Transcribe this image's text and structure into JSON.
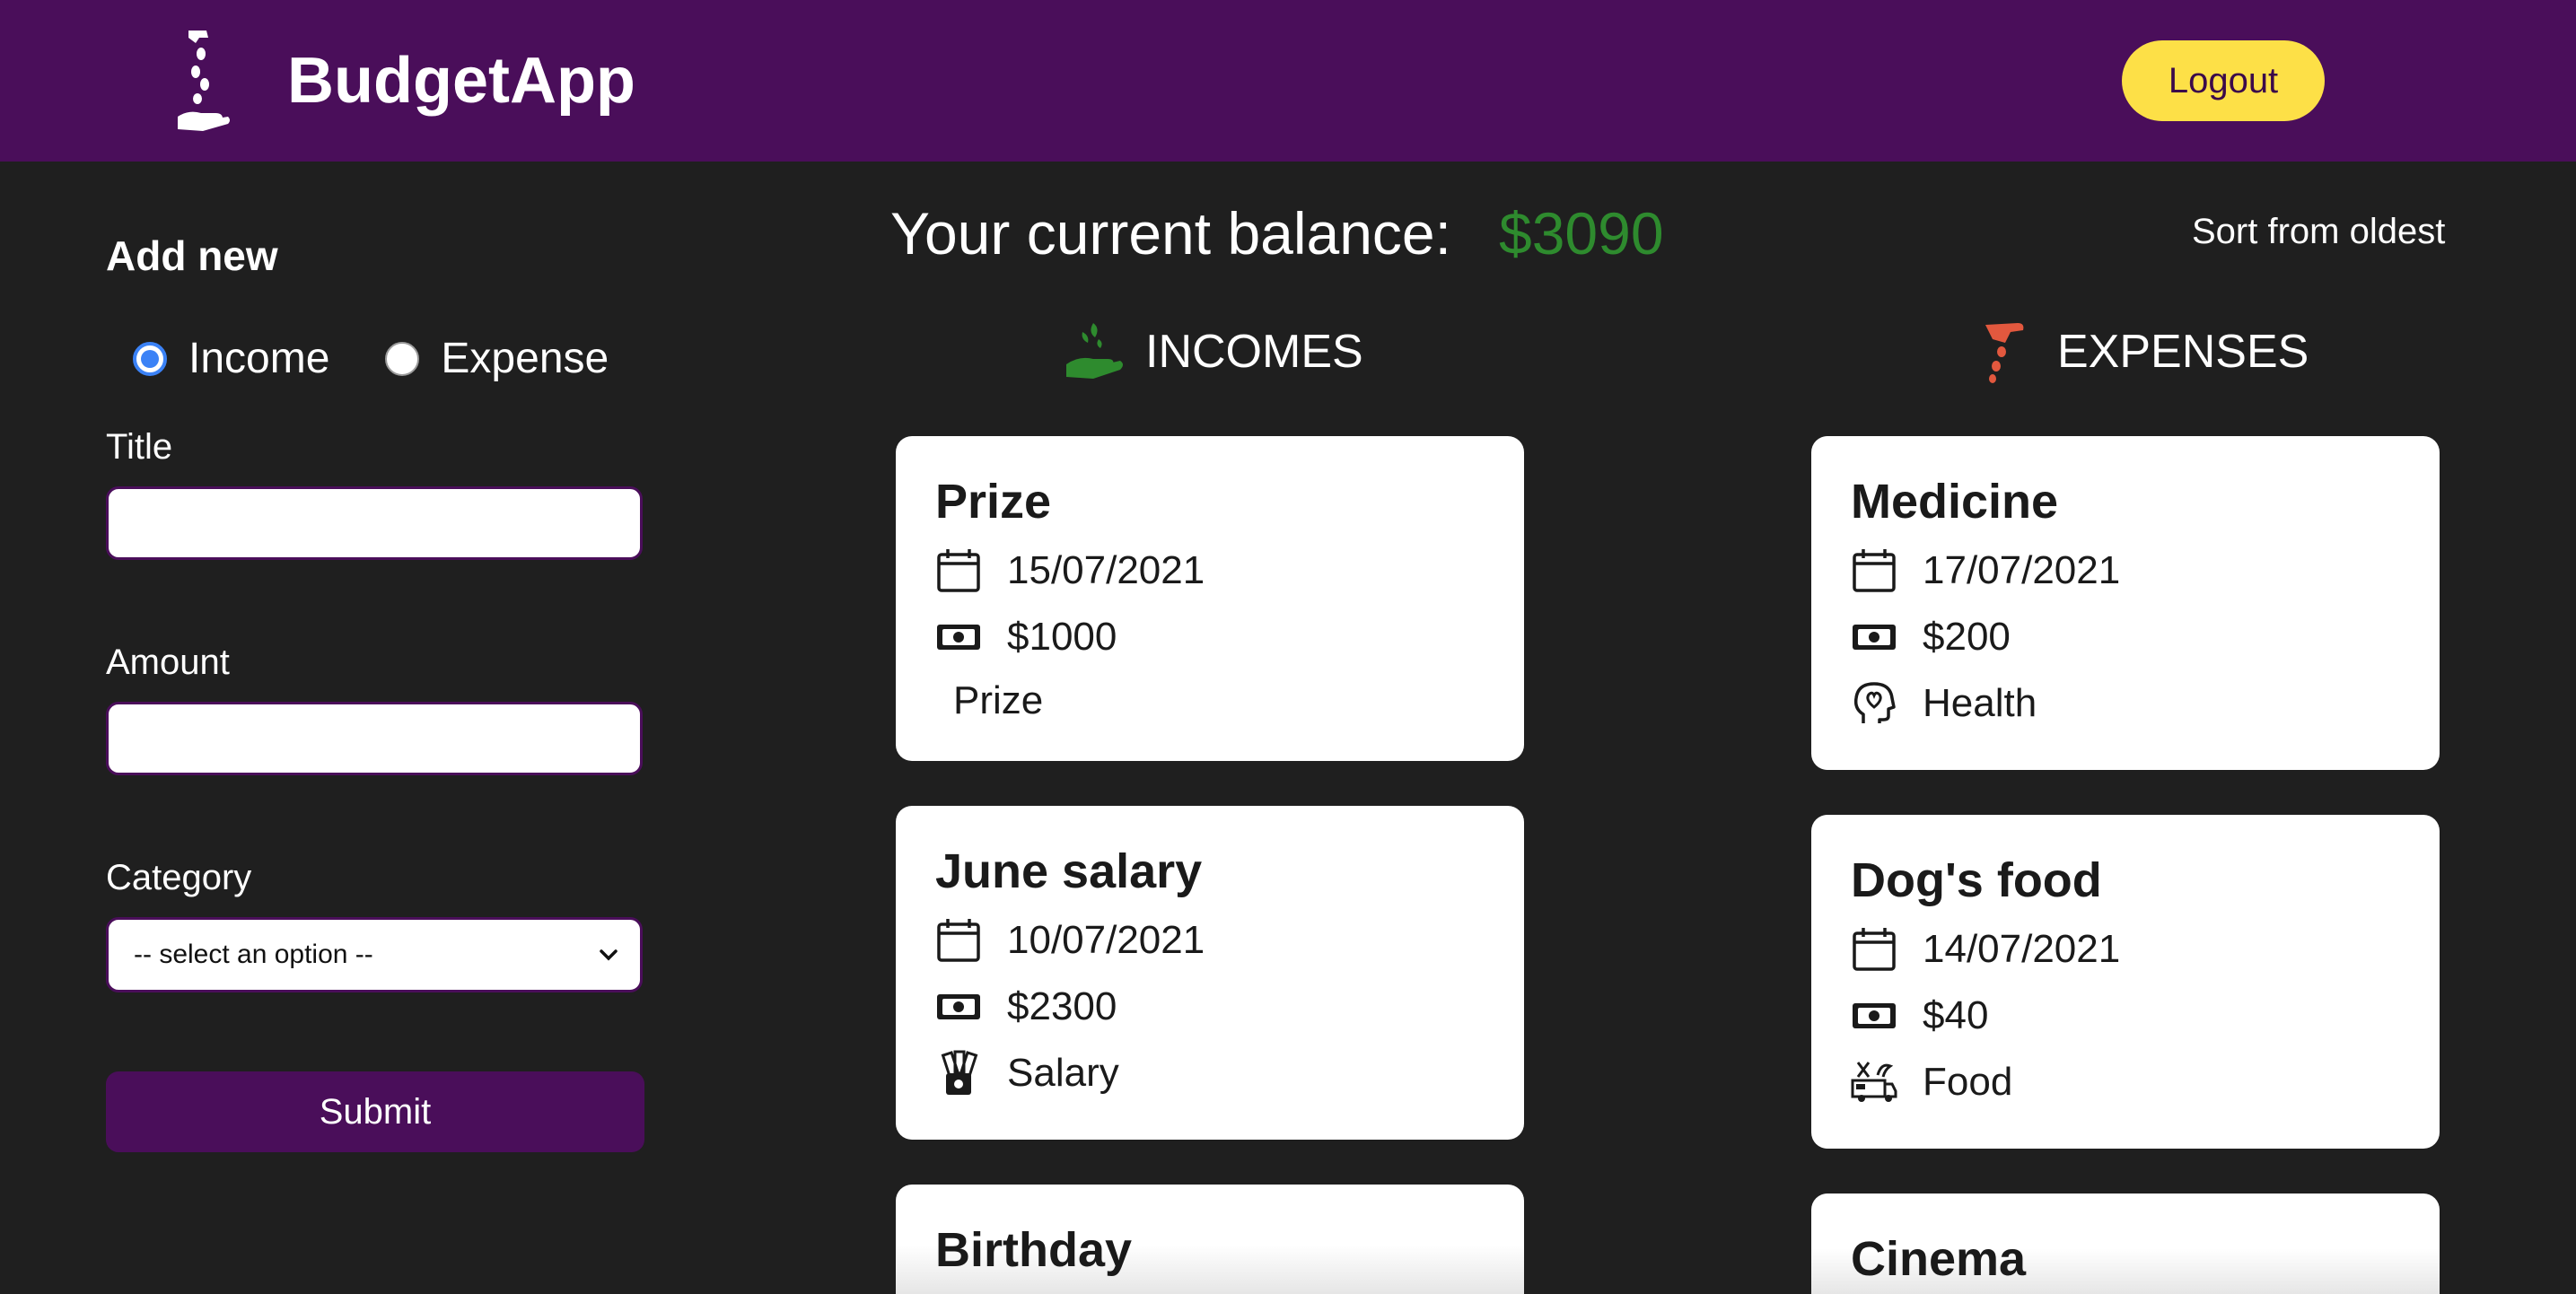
{
  "header": {
    "brand": "BudgetApp",
    "logout_label": "Logout",
    "logo_icon": "coin-hand-icon"
  },
  "colors": {
    "header_bg": "#4a0e5a",
    "page_bg": "#1f1f1f",
    "logout_bg": "#fde047",
    "balance": "#2e8b2e",
    "income_icon": "#2e8b2e",
    "expense_icon": "#e2583e",
    "radio_accent": "#3b82f6"
  },
  "form": {
    "title": "Add new",
    "type_options": [
      {
        "label": "Income",
        "checked": true
      },
      {
        "label": "Expense",
        "checked": false
      }
    ],
    "title_label": "Title",
    "title_value": "",
    "amount_label": "Amount",
    "amount_value": "",
    "category_label": "Category",
    "category_selected": "-- select an option --",
    "submit_label": "Submit"
  },
  "balance": {
    "label": "Your current balance:",
    "value": "$3090"
  },
  "sort_label": "Sort from oldest",
  "incomes": {
    "heading": "INCOMES",
    "items": [
      {
        "title": "Prize",
        "date": "15/07/2021",
        "amount": "$1000",
        "category": "Prize"
      },
      {
        "title": "June salary",
        "date": "10/07/2021",
        "amount": "$2300",
        "category": "Salary"
      },
      {
        "title": "Birthday"
      }
    ]
  },
  "expenses": {
    "heading": "EXPENSES",
    "items": [
      {
        "title": "Medicine",
        "date": "17/07/2021",
        "amount": "$200",
        "category": "Health"
      },
      {
        "title": "Dog's food",
        "date": "14/07/2021",
        "amount": "$40",
        "category": "Food"
      },
      {
        "title": "Cinema"
      }
    ]
  }
}
